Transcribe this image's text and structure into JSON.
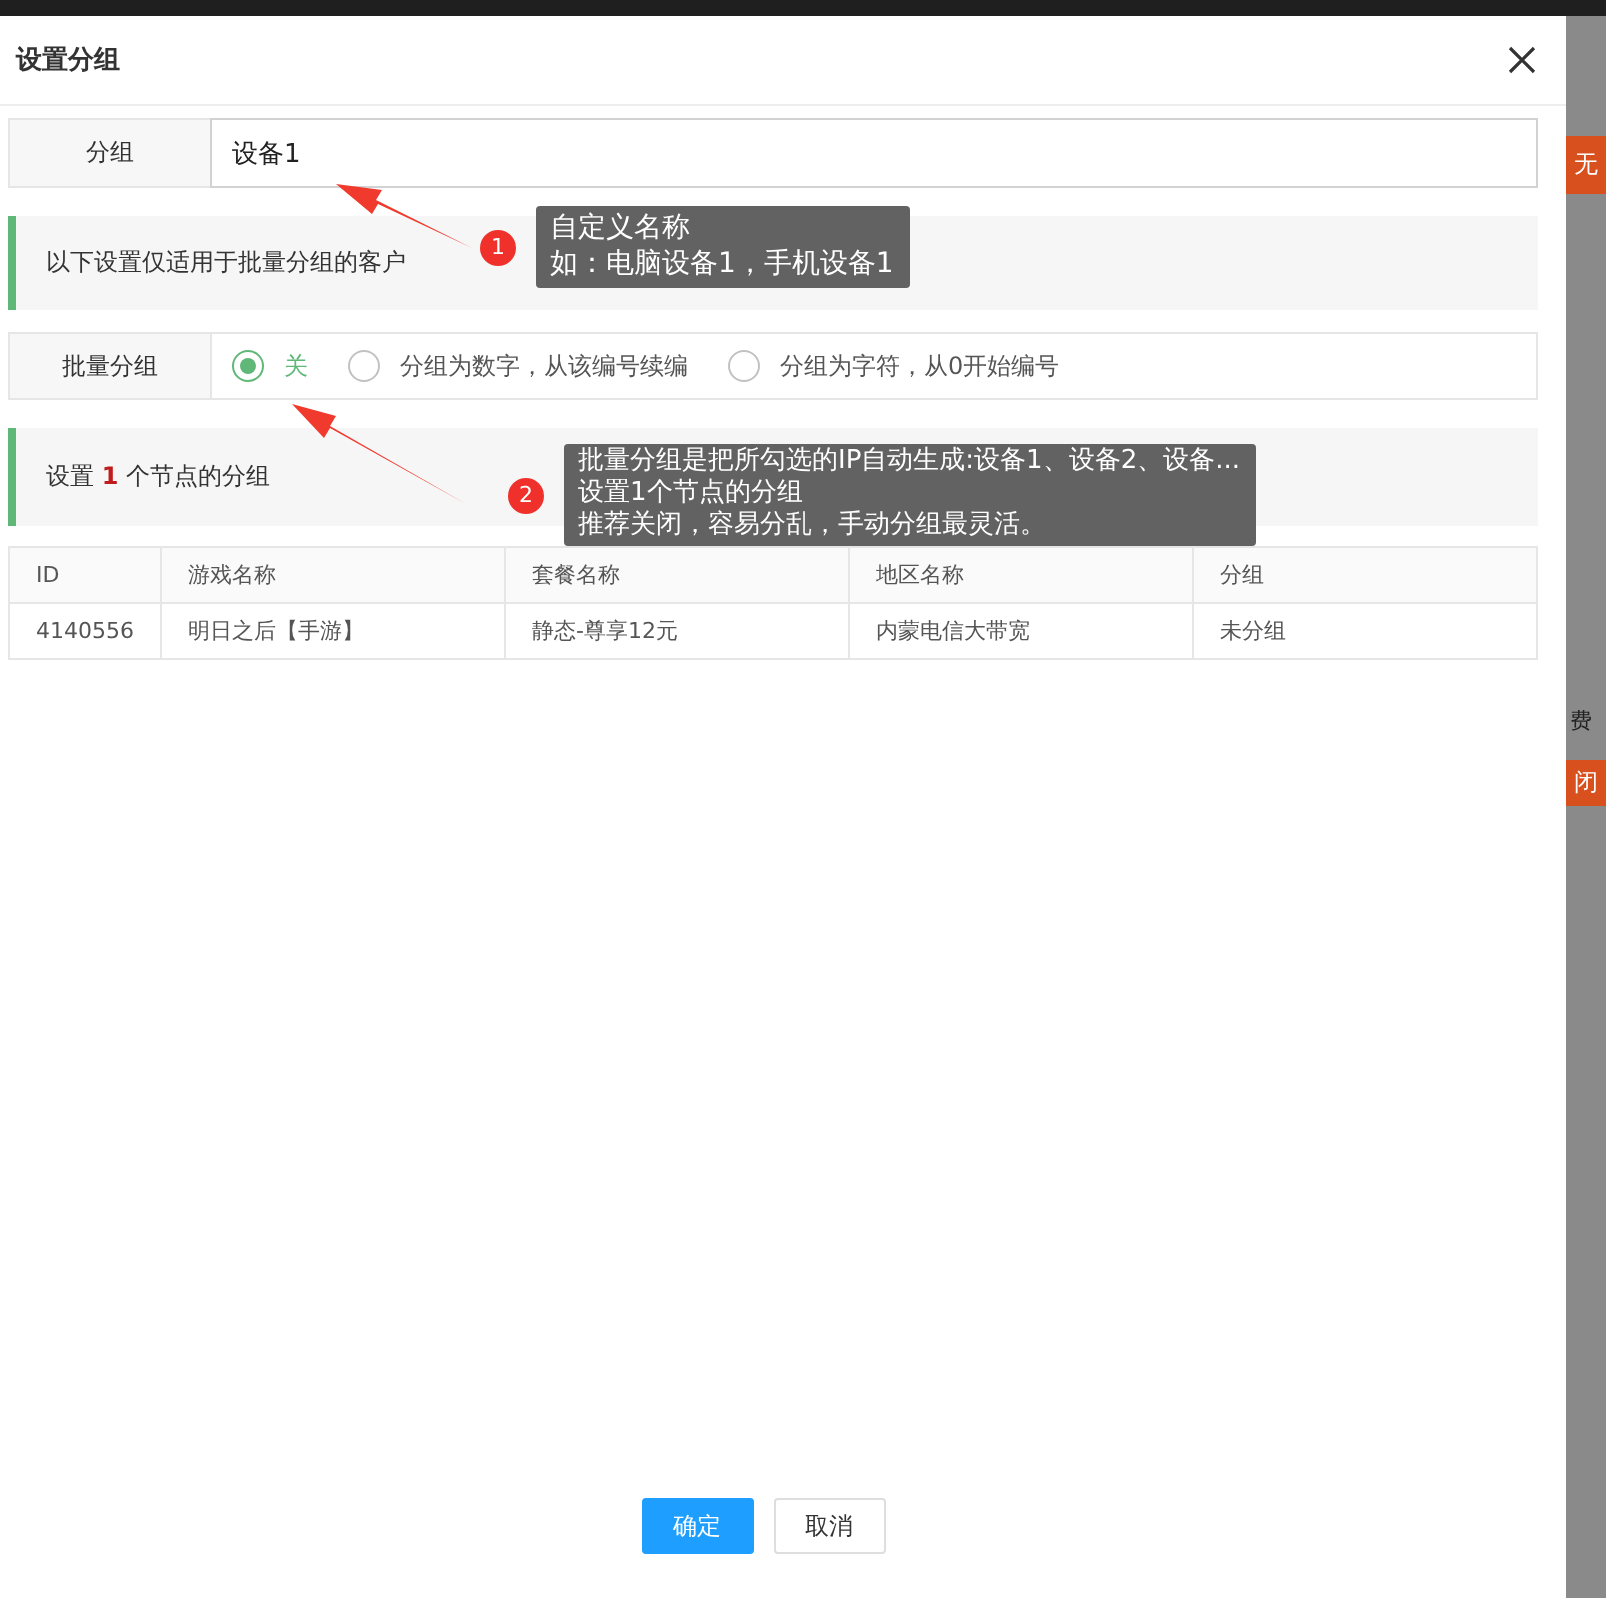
{
  "dialog": {
    "title": "设置分组",
    "group_field": {
      "label": "分组",
      "value": "设备1"
    },
    "notice": "以下设置仅适用于批量分组的客户",
    "batch": {
      "label": "批量分组",
      "options": [
        {
          "label": "关",
          "selected": true
        },
        {
          "label": "分组为数字，从该编号续编",
          "selected": false
        },
        {
          "label": "分组为字符，从0开始编号",
          "selected": false
        }
      ]
    },
    "summary": "设置 **1** 个节点的分组",
    "table": {
      "columns": [
        "ID",
        "游戏名称",
        "套餐名称",
        "地区名称",
        "分组"
      ],
      "rows": [
        [
          "4140556",
          "明日之后【手游】",
          "静态-尊享12元",
          "内蒙电信大带宽",
          "未分组"
        ]
      ]
    },
    "buttons": [
      {
        "label": "确定",
        "kind": "primary"
      },
      {
        "label": "取消",
        "kind": "plain"
      }
    ]
  },
  "callouts": [
    {
      "number": "1",
      "lines": [
        "自定义名称",
        "如：电脑设备1，手机设备1"
      ]
    },
    {
      "number": "2",
      "lines": [
        "批量分组是把所勾选的IP自动生成:设备1、设备2、设备...",
        "设置1个节点的分组",
        "推荐关闭，容易分乱，手动分组最灵活。"
      ]
    }
  ],
  "background": [
    {
      "text": "无",
      "kind": "button"
    },
    {
      "text": "费",
      "kind": "text"
    },
    {
      "text": "闭",
      "kind": "button"
    }
  ]
}
